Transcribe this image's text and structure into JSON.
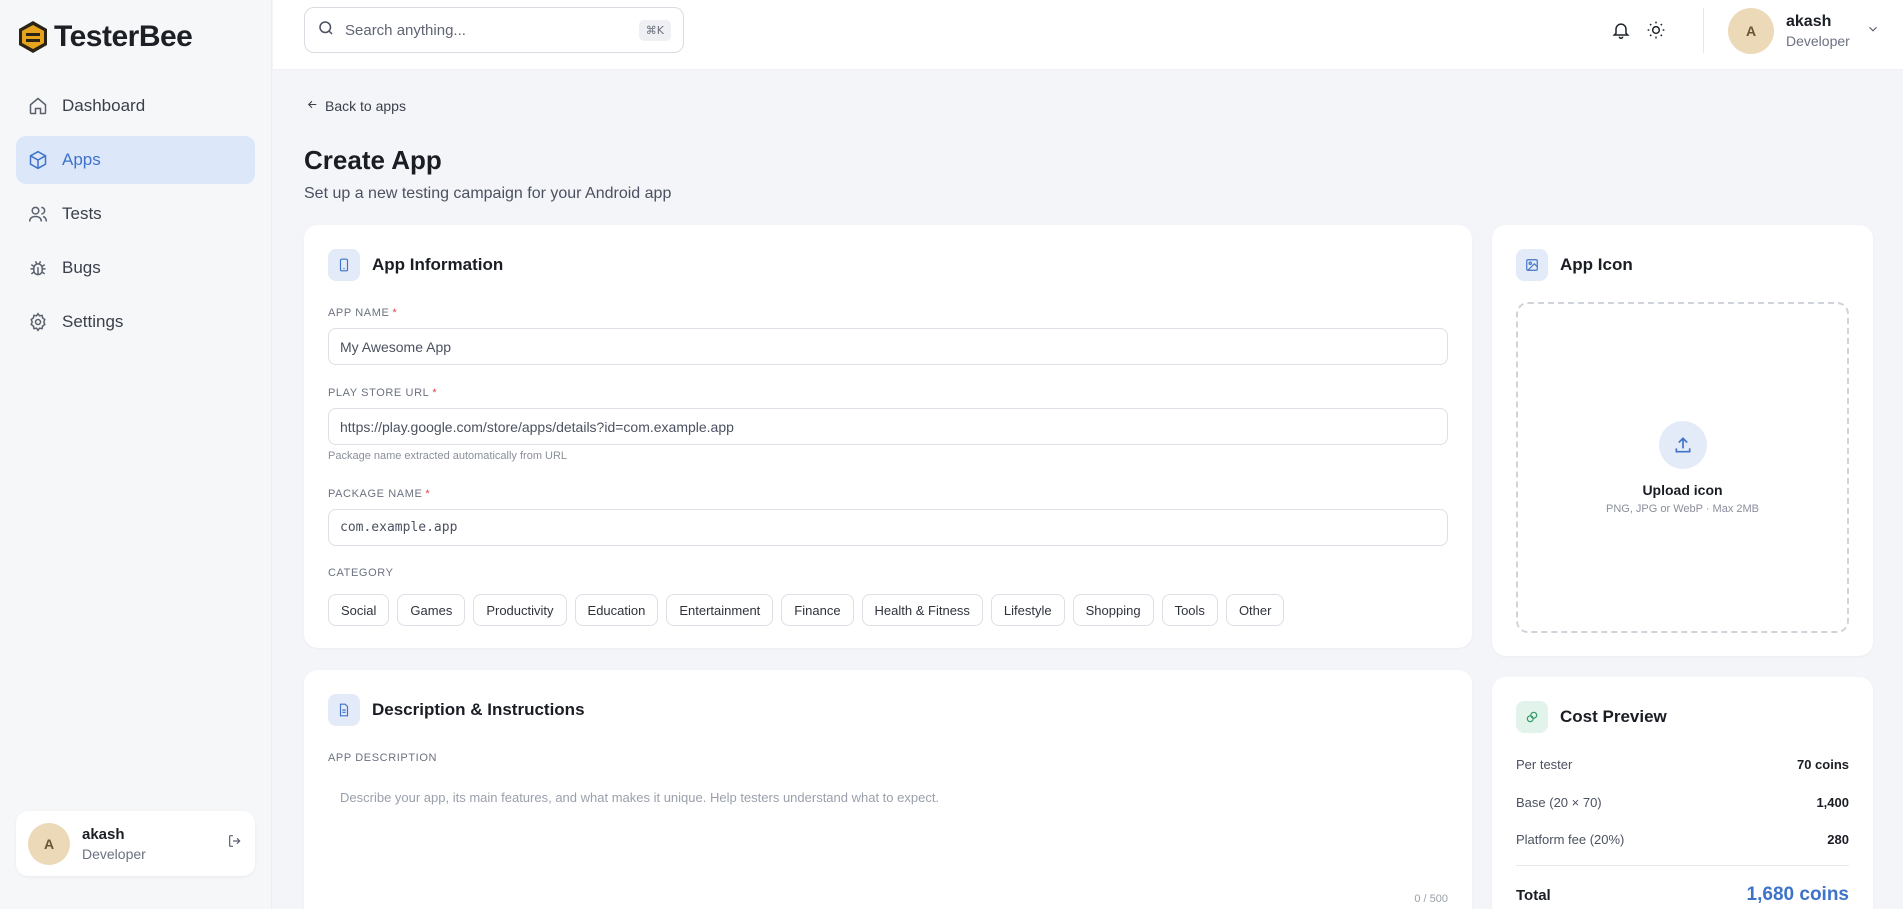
{
  "brand": {
    "name": "TesterBee"
  },
  "sidebar": {
    "items": [
      {
        "label": "Dashboard",
        "icon": "home-icon"
      },
      {
        "label": "Apps",
        "icon": "box-icon",
        "active": true
      },
      {
        "label": "Tests",
        "icon": "users-icon"
      },
      {
        "label": "Bugs",
        "icon": "bug-icon"
      },
      {
        "label": "Settings",
        "icon": "gear-icon"
      }
    ],
    "user": {
      "initial": "A",
      "name": "akash",
      "role": "Developer"
    }
  },
  "header": {
    "search_placeholder": "Search anything...",
    "shortcut": "⌘K",
    "user": {
      "initial": "A",
      "name": "akash",
      "role": "Developer"
    }
  },
  "page": {
    "back_label": "Back to apps",
    "title": "Create App",
    "subtitle": "Set up a new testing campaign for your Android app"
  },
  "app_info": {
    "title": "App Information",
    "app_name_label": "APP NAME",
    "app_name_placeholder": "My Awesome App",
    "play_url_label": "PLAY STORE URL",
    "play_url_placeholder": "https://play.google.com/store/apps/details?id=com.example.app",
    "play_url_hint": "Package name extracted automatically from URL",
    "package_label": "PACKAGE NAME",
    "package_placeholder": "com.example.app",
    "category_label": "CATEGORY",
    "categories": [
      "Social",
      "Games",
      "Productivity",
      "Education",
      "Entertainment",
      "Finance",
      "Health & Fitness",
      "Lifestyle",
      "Shopping",
      "Tools",
      "Other"
    ],
    "required_mark": "*"
  },
  "description": {
    "title": "Description & Instructions",
    "app_desc_label": "APP DESCRIPTION",
    "app_desc_placeholder": "Describe your app, its main features, and what makes it unique. Help testers understand what to expect.",
    "counter": "0 / 500"
  },
  "app_icon": {
    "title": "App Icon",
    "upload_label": "Upload icon",
    "upload_hint": "PNG, JPG or WebP · Max 2MB"
  },
  "cost": {
    "title": "Cost Preview",
    "rows": [
      {
        "label": "Per tester",
        "value": "70 coins"
      },
      {
        "label": "Base (20 × 70)",
        "value": "1,400"
      },
      {
        "label": "Platform fee (20%)",
        "value": "280"
      }
    ],
    "total_label": "Total",
    "total_value": "1,680 coins"
  },
  "colors": {
    "accent": "#3f73c9",
    "active_bg": "#dce7fa",
    "required": "#d9434a"
  }
}
